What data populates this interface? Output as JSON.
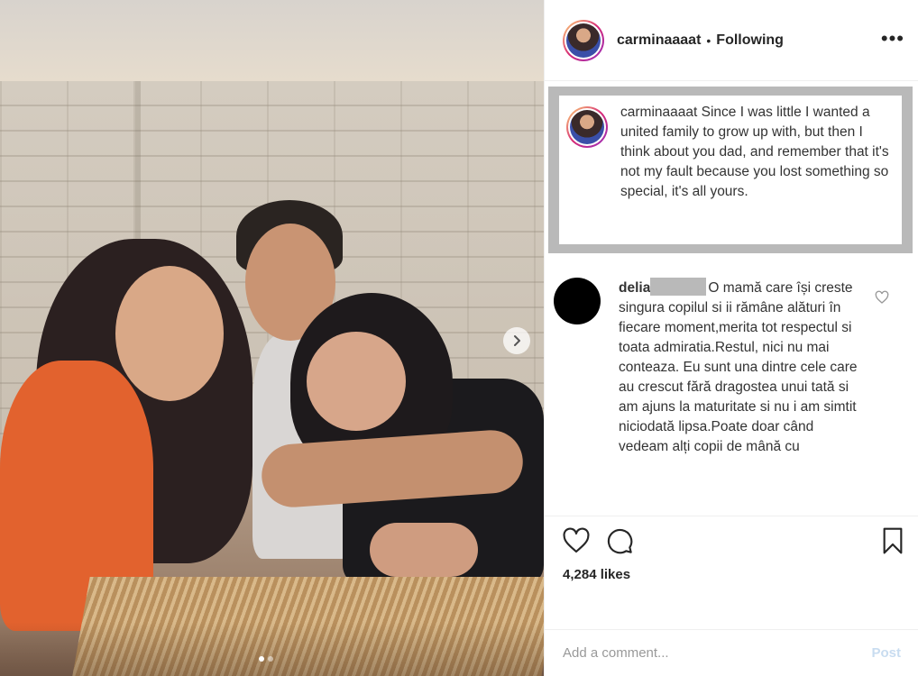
{
  "post": {
    "carousel_total": 2,
    "carousel_active": 1
  },
  "header": {
    "username": "carminaaaat",
    "separator": "•",
    "follow_status": "Following",
    "more_label": "•••"
  },
  "caption": {
    "username": "carminaaaat",
    "text": "Since I was little I wanted a united family to grow up with, but then I think about you dad, and remember that it's not my fault because you lost something so special, it's all yours."
  },
  "comment": {
    "username": "delia",
    "text": "O mamă care își creste singura copilul si ii rămâne alături în fiecare moment,merita tot respectul si toata admiratia.Restul, nici nu mai conteaza. Eu sunt una dintre cele care au crescut fără dragostea unui tată si am ajuns la maturitate si nu i am simtit niciodată lipsa.Poate doar când vedeam alți copii de mână cu"
  },
  "actions": {
    "likes": "4,284 likes"
  },
  "add_comment": {
    "placeholder": "Add a comment...",
    "post_label": "Post"
  },
  "icons": {
    "like": "heart-icon",
    "comment": "comment-bubble-icon",
    "save": "bookmark-icon",
    "next": "chevron-right-icon",
    "more": "more-options-icon"
  },
  "colors": {
    "text": "#262626",
    "border": "#efefef",
    "post_disabled": "#c8dcf0",
    "redaction": "#b9b9b9"
  }
}
